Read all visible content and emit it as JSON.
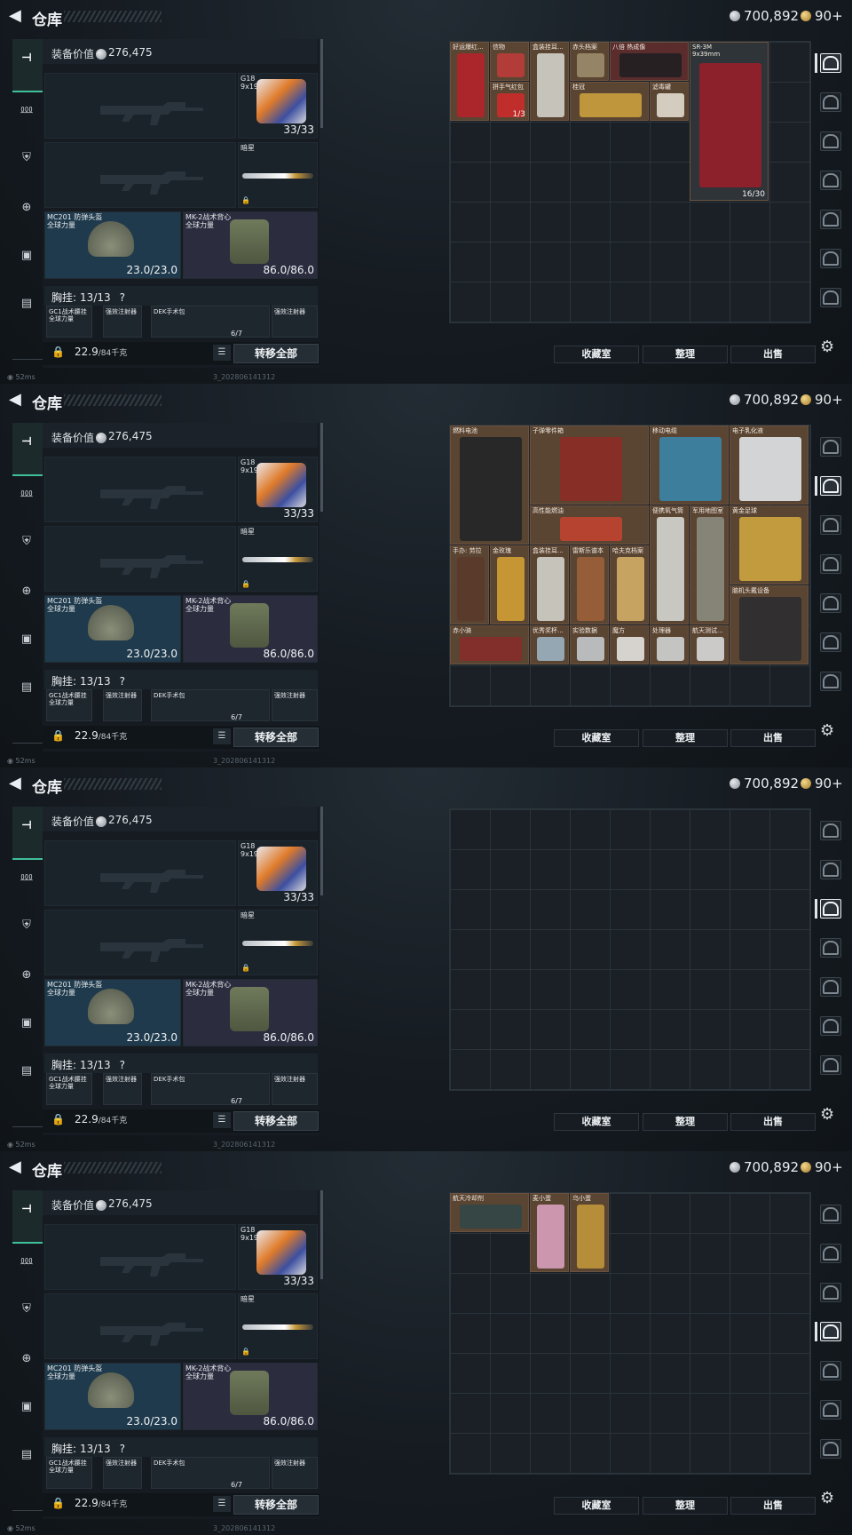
{
  "header": {
    "title": "仓库",
    "back_icon": "back-arrow-icon",
    "currency_a": "700,892",
    "currency_b": "90+"
  },
  "loadout": {
    "value_label": "装备价值",
    "value": "276,475",
    "secondary_name": "G18",
    "secondary_caliber": "9x19mm",
    "secondary_ammo": "33/33",
    "melee_name": "暗星",
    "helmet_name": "MC201 防弹头盔",
    "helmet_sub": "全球力量",
    "helmet_dur": "23.0/23.0",
    "vest_name": "MK-2战术背心",
    "vest_sub": "全球力量",
    "vest_dur": "86.0/86.0",
    "chest_label": "胸挂:",
    "chest_val": "13/13",
    "chest_q": "?",
    "rig1": "GC1战术腰挂",
    "rig1_sub": "全球力量",
    "rig2": "强效注射器",
    "rig3": "DEK手术包",
    "rig3_count": "6/7",
    "rig4": "强效注射器",
    "weight": "22.9",
    "weight_unit": "/84千克",
    "transfer_all": "转移全部"
  },
  "status": {
    "ping": "52ms",
    "build": "3_202806141312"
  },
  "buttons": {
    "collection": "收藏室",
    "arrange": "整理",
    "sell": "出售"
  },
  "panels": [
    {
      "active_tab": 0,
      "items": [
        {
          "name": "好运爆红...",
          "col": 0,
          "row": 0,
          "w": 1,
          "h": 2,
          "tone": "brown",
          "art": "#b8212a"
        },
        {
          "name": "信物",
          "col": 1,
          "row": 0,
          "w": 1,
          "h": 1,
          "tone": "brown",
          "art": "#c23b3a"
        },
        {
          "name": "盒装挂耳...",
          "col": 2,
          "row": 0,
          "w": 1,
          "h": 2,
          "tone": "brown",
          "art": "#d9d9d4"
        },
        {
          "name": "赤头档案",
          "col": 3,
          "row": 0,
          "w": 1,
          "h": 1,
          "tone": "brown",
          "art": "#a08f6e"
        },
        {
          "name": "八倍 热成像",
          "col": 4,
          "row": 0,
          "w": 2,
          "h": 1,
          "tone": "red",
          "art": "#1e1e22"
        },
        {
          "name": "SR-3M",
          "sub": "9x39mm",
          "col": 6,
          "row": 0,
          "w": 2,
          "h": 4,
          "tone": "dark",
          "art": "#9e1f29",
          "count": "16/30"
        },
        {
          "name": "拼手气红包",
          "col": 1,
          "row": 1,
          "w": 1,
          "h": 1,
          "tone": "brown",
          "art": "#d22a2a",
          "count": "1/3"
        },
        {
          "name": "桂冠",
          "col": 3,
          "row": 1,
          "w": 2,
          "h": 1,
          "tone": "brown",
          "art": "#d1a53e"
        },
        {
          "name": "滤毒罐",
          "col": 5,
          "row": 1,
          "w": 1,
          "h": 1,
          "tone": "brown",
          "art": "#e9e4d8"
        }
      ]
    },
    {
      "active_tab": 1,
      "items": [
        {
          "name": "燃料电池",
          "col": 0,
          "row": 0,
          "w": 2,
          "h": 3,
          "tone": "brown",
          "art": "#1f2326"
        },
        {
          "name": "子弹零件箱",
          "col": 2,
          "row": 0,
          "w": 3,
          "h": 2,
          "tone": "brown",
          "art": "#8f2a25"
        },
        {
          "name": "移动电缆",
          "col": 5,
          "row": 0,
          "w": 2,
          "h": 2,
          "tone": "brown",
          "art": "#3a88b0"
        },
        {
          "name": "电子乳化液",
          "col": 7,
          "row": 0,
          "w": 2,
          "h": 2,
          "tone": "brown",
          "art": "#e8edf2"
        },
        {
          "name": "高性能燃油",
          "col": 2,
          "row": 2,
          "w": 3,
          "h": 1,
          "tone": "brown",
          "art": "#c7432f"
        },
        {
          "name": "便携氧气筒",
          "col": 5,
          "row": 2,
          "w": 1,
          "h": 3,
          "tone": "brown",
          "art": "#dcdedb"
        },
        {
          "name": "军用地图室",
          "col": 6,
          "row": 2,
          "w": 1,
          "h": 3,
          "tone": "brown",
          "art": "#8d8f84"
        },
        {
          "name": "黄金足球",
          "col": 7,
          "row": 2,
          "w": 2,
          "h": 2,
          "tone": "brown",
          "art": "#d4aa3f"
        },
        {
          "name": "手办: 劳拉",
          "col": 0,
          "row": 3,
          "w": 1,
          "h": 2,
          "tone": "brown",
          "art": "#5a3a2a"
        },
        {
          "name": "金玫瑰",
          "col": 1,
          "row": 3,
          "w": 1,
          "h": 2,
          "tone": "brown",
          "art": "#d8a434"
        },
        {
          "name": "盒装挂耳...",
          "col": 2,
          "row": 3,
          "w": 1,
          "h": 2,
          "tone": "brown",
          "art": "#d9d9d4"
        },
        {
          "name": "雷斯乐谱本",
          "col": 3,
          "row": 3,
          "w": 1,
          "h": 2,
          "tone": "brown",
          "art": "#a0623a"
        },
        {
          "name": "哈夫克档案",
          "col": 4,
          "row": 3,
          "w": 1,
          "h": 2,
          "tone": "brown",
          "art": "#d9b46a"
        },
        {
          "name": "脑机头戴设备",
          "col": 7,
          "row": 4,
          "w": 2,
          "h": 2,
          "tone": "brown",
          "art": "#2a2c30"
        },
        {
          "name": "赤小骑",
          "col": 0,
          "row": 5,
          "w": 2,
          "h": 1,
          "tone": "brown",
          "art": "#8a2a2a"
        },
        {
          "name": "优秀奖杯...",
          "col": 2,
          "row": 5,
          "w": 1,
          "h": 1,
          "tone": "brown",
          "art": "#9fb8c9"
        },
        {
          "name": "实验数据",
          "col": 3,
          "row": 5,
          "w": 1,
          "h": 1,
          "tone": "brown",
          "art": "#c9cfd3"
        },
        {
          "name": "魔方",
          "col": 4,
          "row": 5,
          "w": 1,
          "h": 1,
          "tone": "brown",
          "art": "#ececea"
        },
        {
          "name": "处理器",
          "col": 5,
          "row": 5,
          "w": 1,
          "h": 1,
          "tone": "brown",
          "art": "#d7dadc"
        },
        {
          "name": "航天测试...",
          "col": 6,
          "row": 5,
          "w": 1,
          "h": 1,
          "tone": "brown",
          "art": "#dfe2e3"
        }
      ]
    },
    {
      "active_tab": 2,
      "items": []
    },
    {
      "active_tab": 3,
      "items": [
        {
          "name": "航天冷却剂",
          "col": 0,
          "row": 0,
          "w": 2,
          "h": 1,
          "tone": "brown",
          "art": "#2f4648"
        },
        {
          "name": "麦小蛋",
          "col": 2,
          "row": 0,
          "w": 1,
          "h": 2,
          "tone": "brown",
          "art": "#e0a5c6"
        },
        {
          "name": "乌小蛋",
          "col": 3,
          "row": 0,
          "w": 1,
          "h": 2,
          "tone": "brown",
          "art": "#c79a3b"
        }
      ]
    }
  ]
}
